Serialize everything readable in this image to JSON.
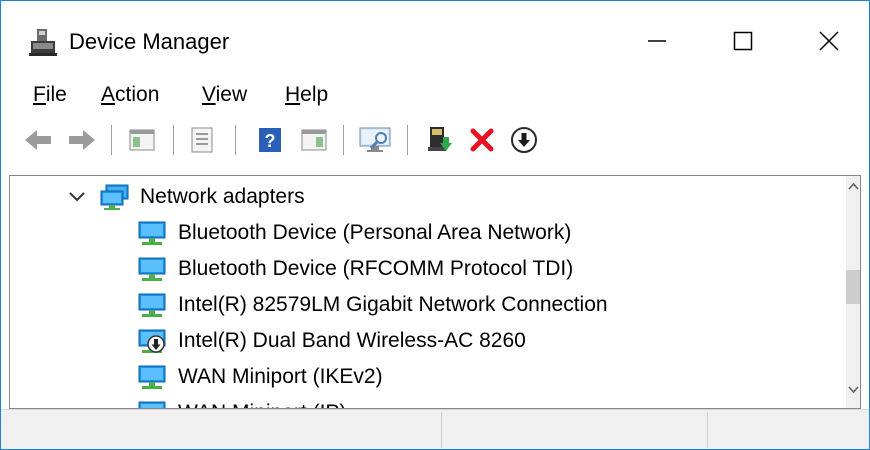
{
  "window": {
    "title": "Device Manager",
    "controls": {
      "minimize": "minimize",
      "maximize": "maximize",
      "close": "close"
    }
  },
  "menu": {
    "file": {
      "accel": "F",
      "rest": "ile"
    },
    "action": {
      "accel": "A",
      "rest": "ction"
    },
    "view": {
      "accel": "V",
      "rest": "iew"
    },
    "help": {
      "accel": "H",
      "rest": "elp"
    }
  },
  "toolbar": {
    "buttons": [
      "back-arrow-icon",
      "forward-arrow-icon",
      "show-hide-console-tree-icon",
      "properties-icon",
      "help-icon",
      "action-pane-icon",
      "scan-hardware-changes-icon",
      "update-driver-icon",
      "uninstall-device-icon",
      "disable-device-icon"
    ]
  },
  "tree": {
    "category": "Network adapters",
    "items": [
      {
        "label": "Bluetooth Device (Personal Area Network)",
        "icon": "network-adapter-icon"
      },
      {
        "label": "Bluetooth Device (RFCOMM Protocol TDI)",
        "icon": "network-adapter-icon"
      },
      {
        "label": "Intel(R) 82579LM Gigabit Network Connection",
        "icon": "network-adapter-icon"
      },
      {
        "label": "Intel(R) Dual Band Wireless-AC 8260",
        "icon": "network-adapter-disabled-icon"
      },
      {
        "label": "WAN Miniport (IKEv2)",
        "icon": "network-adapter-icon"
      },
      {
        "label": "WAN Miniport (IP)",
        "icon": "network-adapter-icon"
      }
    ]
  },
  "colors": {
    "accent": "#1883d7",
    "uninstall_red": "#e81123",
    "monitor_blue": "#1e90e0",
    "cable_green": "#4cae4c"
  }
}
